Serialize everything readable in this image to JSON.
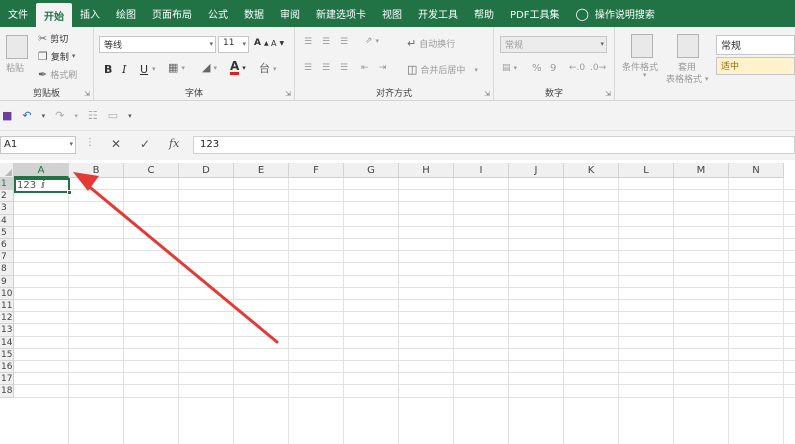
{
  "menubar": {
    "tabs": [
      {
        "label": "文件"
      },
      {
        "label": "开始",
        "active": true
      },
      {
        "label": "插入"
      },
      {
        "label": "绘图"
      },
      {
        "label": "页面布局"
      },
      {
        "label": "公式"
      },
      {
        "label": "数据"
      },
      {
        "label": "审阅"
      },
      {
        "label": "新建选项卡"
      },
      {
        "label": "视图"
      },
      {
        "label": "开发工具"
      },
      {
        "label": "帮助"
      },
      {
        "label": "PDF工具集"
      }
    ],
    "tell_me": "操作说明搜索"
  },
  "ribbon": {
    "clipboard": {
      "paste": "粘贴",
      "cut": "剪切",
      "copy": "复制",
      "format_painter": "格式刷",
      "label": "剪贴板"
    },
    "font": {
      "font_name": "等线",
      "font_size": "11",
      "grow": "A",
      "shrink": "A",
      "bold": "B",
      "italic": "I",
      "underline": "U",
      "font_color_letter": "A",
      "label": "字体"
    },
    "alignment": {
      "wrap_text": "自动换行",
      "merge_center": "合并后居中",
      "label": "对齐方式"
    },
    "number": {
      "format": "常规",
      "percent": "%",
      "comma": "9",
      "label": "数字"
    },
    "styles": {
      "conditional": "条件格式",
      "format_table_line1": "套用",
      "format_table_line2": "表格格式",
      "style_normal": "常规",
      "style_neutral": "适中"
    }
  },
  "formula_bar": {
    "name_box": "A1",
    "cancel": "✕",
    "enter": "✓",
    "fx": "fx",
    "content": "123"
  },
  "sheet": {
    "columns": [
      "A",
      "B",
      "C",
      "D",
      "E",
      "F",
      "G",
      "H",
      "I",
      "J",
      "K",
      "L",
      "M",
      "N"
    ],
    "rows": [
      "1",
      "2",
      "3",
      "4",
      "5",
      "6",
      "7",
      "8",
      "9",
      "10",
      "11",
      "12",
      "13",
      "14",
      "15",
      "16",
      "17",
      "18"
    ],
    "a1_value": "123",
    "active_column": "A",
    "active_row": "1"
  },
  "colors": {
    "accent": "#217346",
    "annotation_arrow": "#e53935"
  }
}
